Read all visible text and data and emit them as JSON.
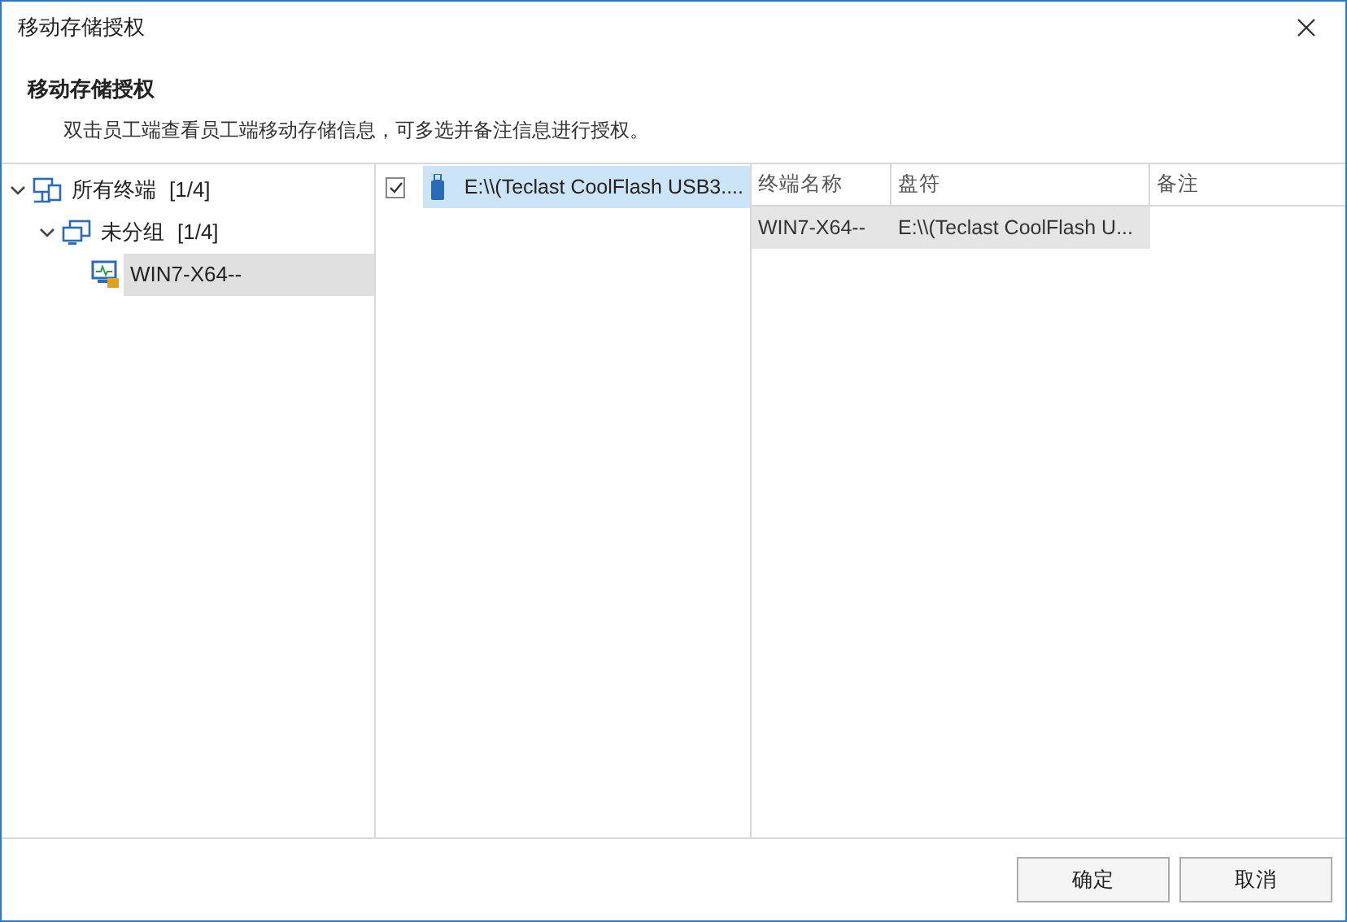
{
  "window": {
    "title": "移动存储授权"
  },
  "header": {
    "title": "移动存储授权",
    "description": "双击员工端查看员工端移动存储信息，可多选并备注信息进行授权。"
  },
  "tree": [
    {
      "label": "所有终端",
      "count": "[1/4]",
      "kind": "network",
      "expanded": true,
      "selected": false,
      "children": [
        {
          "label": "未分组",
          "count": "[1/4]",
          "kind": "group",
          "expanded": true,
          "selected": false,
          "children": [
            {
              "label": "WIN7-X64--",
              "kind": "computer",
              "selected": true
            }
          ]
        }
      ]
    }
  ],
  "devices": [
    {
      "label": "E:\\\\(Teclast CoolFlash USB3....",
      "checked": true,
      "selected": true
    }
  ],
  "table": {
    "columns": [
      "终端名称",
      "盘符",
      "备注"
    ],
    "rows": [
      {
        "cells": [
          "WIN7-X64--",
          "E:\\\\(Teclast CoolFlash U..."
        ],
        "selected": true
      }
    ]
  },
  "buttons": [
    "确定",
    "取消"
  ]
}
